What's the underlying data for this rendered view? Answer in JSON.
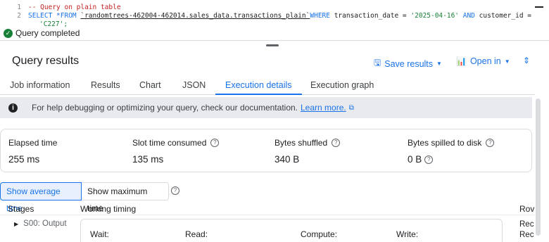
{
  "editor": {
    "line1_no": "1",
    "line1_comment": "-- Query on plain table",
    "line2_no": "2",
    "line2_select": "SELECT *FROM ",
    "line2_table": "`randomtrees-462004-462014.sales_data.transactions_plain`",
    "line2_where": "WHERE ",
    "line2_cond1": "transaction_date = ",
    "line2_date": "'2025-04-16'",
    "line2_and": " AND ",
    "line2_cond2": "customer_id =",
    "line3_partial": "'C227';"
  },
  "status": {
    "text": "Query completed"
  },
  "header": {
    "title": "Query results",
    "save_label": "Save results",
    "open_label": "Open in"
  },
  "tabs": [
    {
      "label": "Job information"
    },
    {
      "label": "Results"
    },
    {
      "label": "Chart"
    },
    {
      "label": "JSON"
    },
    {
      "label": "Execution details",
      "active": true
    },
    {
      "label": "Execution graph"
    }
  ],
  "banner": {
    "text": "For help debugging or optimizing your query, check our documentation.",
    "link": "Learn more."
  },
  "stats": [
    {
      "label": "Elapsed time",
      "value": "255 ms"
    },
    {
      "label": "Slot time consumed",
      "value": "135 ms"
    },
    {
      "label": "Bytes shuffled",
      "value": "340 B"
    },
    {
      "label": "Bytes spilled to disk",
      "value": "0 B"
    }
  ],
  "toggle": {
    "average": "Show average time",
    "maximum": "Show maximum time"
  },
  "table": {
    "col_stages": "Stages",
    "col_timing": "Working timing",
    "col_rows": "Rov",
    "stage_name": "S00: Output",
    "wait": "Wait:",
    "read": "Read:",
    "compute": "Compute:",
    "write": "Write:",
    "rec1": "Rec",
    "rec2": "Rec"
  },
  "colors": {
    "accent": "#1a73e8",
    "success": "#188038",
    "banner_bg": "#e8eaed"
  }
}
